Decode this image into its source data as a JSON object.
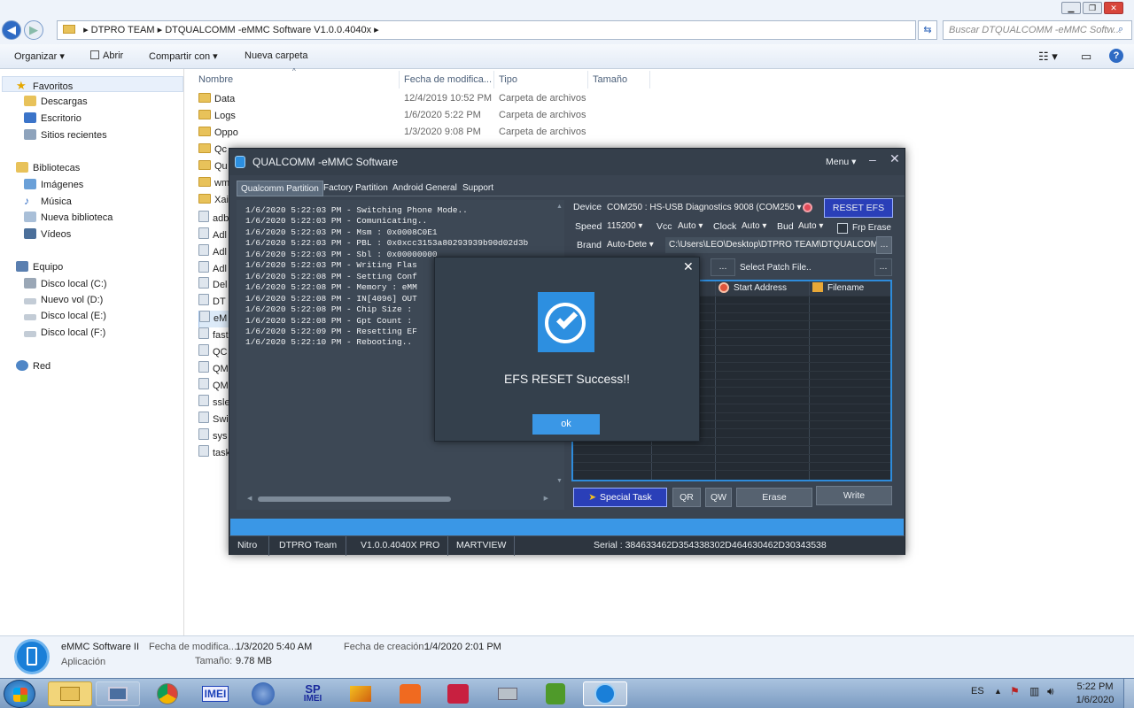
{
  "explorer": {
    "breadcrumb": [
      "DTPRO TEAM",
      "DTQUALCOMM -eMMC Software V1.0.0.4040x"
    ],
    "search_placeholder": "Buscar DTQUALCOMM -eMMC Softw...",
    "toolbar": {
      "organize": "Organizar",
      "open": "Abrir",
      "share": "Compartir con",
      "new_folder": "Nueva carpeta"
    },
    "nav": {
      "favorites": "Favoritos",
      "favorites_items": [
        "Descargas",
        "Escritorio",
        "Sitios recientes"
      ],
      "libraries": "Bibliotecas",
      "libraries_items": [
        "Imágenes",
        "Música",
        "Nueva biblioteca",
        "Vídeos"
      ],
      "computer": "Equipo",
      "computer_items": [
        "Disco local (C:)",
        "Nuevo vol (D:)",
        "Disco local (E:)",
        "Disco local (F:)"
      ],
      "network": "Red"
    },
    "columns": {
      "name": "Nombre",
      "date": "Fecha de modifica...",
      "type": "Tipo",
      "size": "Tamaño"
    },
    "files": [
      {
        "name": "Data",
        "date": "12/4/2019 10:52 PM",
        "type": "Carpeta de archivos"
      },
      {
        "name": "Logs",
        "date": "1/6/2020 5:22 PM",
        "type": "Carpeta de archivos"
      },
      {
        "name": "Oppo",
        "date": "1/3/2020 9:08 PM",
        "type": "Carpeta de archivos"
      },
      {
        "name": "Qc",
        "date": "",
        "type": ""
      },
      {
        "name": "Qu",
        "date": "",
        "type": ""
      },
      {
        "name": "wm",
        "date": "",
        "type": ""
      },
      {
        "name": "Xai",
        "date": "",
        "type": ""
      },
      {
        "name": "adb",
        "date": "",
        "type": ""
      },
      {
        "name": "Adl",
        "date": "",
        "type": ""
      },
      {
        "name": "Adl",
        "date": "",
        "type": ""
      },
      {
        "name": "Adl",
        "date": "",
        "type": ""
      },
      {
        "name": "Del",
        "date": "",
        "type": ""
      },
      {
        "name": "DT",
        "date": "",
        "type": ""
      },
      {
        "name": "eM",
        "date": "",
        "type": ""
      },
      {
        "name": "fast",
        "date": "",
        "type": ""
      },
      {
        "name": "QC",
        "date": "",
        "type": ""
      },
      {
        "name": "QM",
        "date": "",
        "type": ""
      },
      {
        "name": "QM",
        "date": "",
        "type": ""
      },
      {
        "name": "ssle",
        "date": "",
        "type": ""
      },
      {
        "name": "Swi",
        "date": "",
        "type": ""
      },
      {
        "name": "sys",
        "date": "",
        "type": ""
      },
      {
        "name": "task",
        "date": "",
        "type": ""
      }
    ],
    "details": {
      "name": "eMMC Software II",
      "kind": "Aplicación",
      "modified_label": "Fecha de modifica...",
      "modified_value": "1/3/2020 5:40 AM",
      "created_label": "Fecha de creación:",
      "created_value": "1/4/2020 2:01 PM",
      "size_label": "Tamaño:",
      "size_value": "9.78 MB"
    }
  },
  "app": {
    "title": "QUALCOMM -eMMC Software",
    "menu": "Menu",
    "tabs": [
      "Qualcomm Partition",
      "Factory Partition",
      "Android General",
      "Support"
    ],
    "log": [
      "1/6/2020 5:22:03 PM - Switching Phone Mode..",
      "1/6/2020 5:22:03 PM - Comunicating..",
      "1/6/2020 5:22:03 PM - Msm : 0x0008C0E1",
      "1/6/2020 5:22:03 PM - PBL : 0x0xcc3153a80293939b90d02d3b",
      "1/6/2020 5:22:03 PM - Sbl : 0x00000000",
      "1/6/2020 5:22:03 PM - Writing Flas",
      "1/6/2020 5:22:08 PM - Setting Conf",
      "1/6/2020 5:22:08 PM - Memory : eMM",
      "1/6/2020 5:22:08 PM - IN[4096] OUT",
      "1/6/2020 5:22:08 PM - Chip Size :",
      "1/6/2020 5:22:08 PM - Gpt Count :",
      "1/6/2020 5:22:09 PM - Resetting EF",
      "1/6/2020 5:22:10 PM - Rebooting.."
    ],
    "device_label": "Device",
    "device_value": "COM250 : HS-USB Diagnostics 9008 (COM250",
    "reset_efs": "RESET EFS",
    "speed_label": "Speed",
    "speed_value": "115200",
    "vcc_label": "Vcc",
    "vcc_value": "Auto",
    "clock_label": "Clock",
    "clock_value": "Auto",
    "bud_label": "Bud",
    "bud_value": "Auto",
    "frp_erase": "Frp Erase",
    "brand_label": "Brand",
    "brand_value": "Auto-Dete",
    "path": "C:\\Users\\LEO\\Desktop\\DTPRO TEAM\\DTQUALCOM",
    "patch_dots": "...",
    "select_patch": "Select Patch File..",
    "patch_dots2": "...",
    "table_cols": [
      "Start Address",
      "Filename"
    ],
    "buttons": {
      "special_task": "Special Task",
      "qr": "QR",
      "qw": "QW",
      "erase": "Erase",
      "write": "Write"
    },
    "dialog": {
      "message": "EFS RESET Success!!",
      "ok": "ok"
    },
    "status": {
      "a": "Nitro",
      "b": "DTPRO Team",
      "c": "V1.0.0.4040X PRO",
      "d": "MARTVIEW",
      "serial": "Serial : 384633462D354338302D464630462D30343538"
    }
  },
  "taskbar": {
    "lang": "ES",
    "time": "5:22 PM",
    "date": "1/6/2020",
    "imei_label": "IMEI",
    "sp": "SP",
    "sp_imei": "IMEI"
  },
  "colors": {
    "accent": "#3a97e6",
    "app_bg": "#3a4451",
    "reset_btn": "#2a3fb8"
  }
}
